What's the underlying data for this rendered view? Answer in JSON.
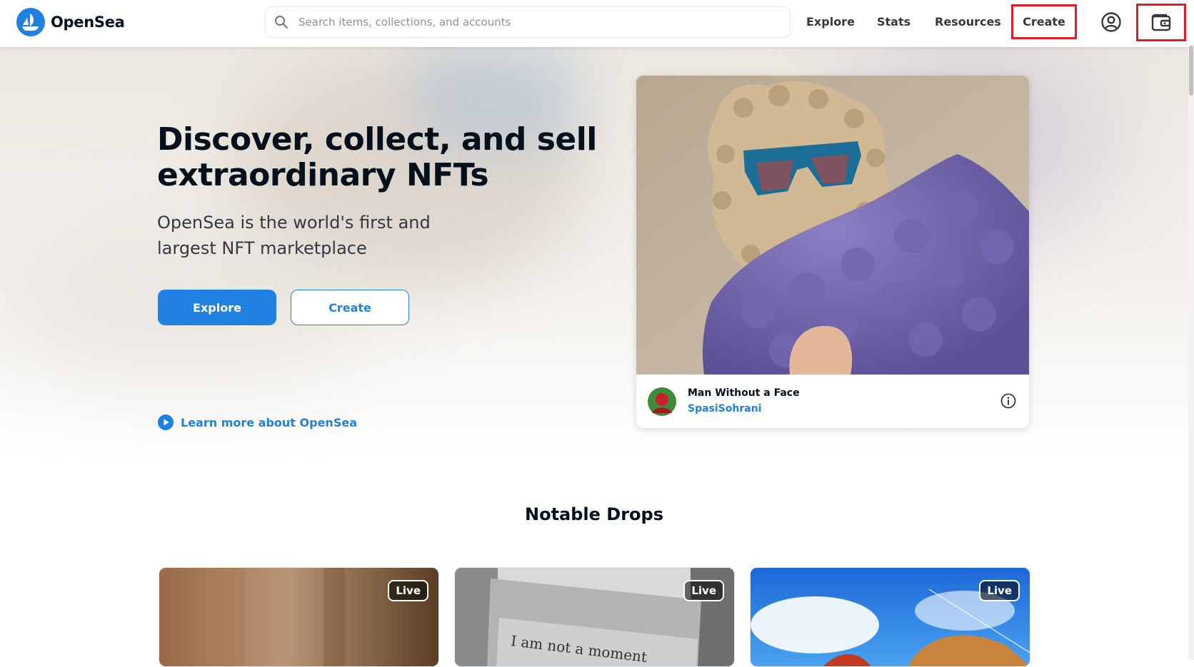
{
  "header": {
    "brand": "OpenSea",
    "search": {
      "placeholder": "Search items, collections, and accounts",
      "value": ""
    },
    "nav": {
      "explore": "Explore",
      "stats": "Stats",
      "resources": "Resources",
      "create": "Create"
    },
    "icons": {
      "logo": "opensea-logo-icon",
      "search": "search-icon",
      "account": "account-circle-icon",
      "wallet": "wallet-icon"
    }
  },
  "hero": {
    "title": "Discover, collect, and sell extraordinary NFTs",
    "subtitle": "OpenSea is the world's first and largest NFT marketplace",
    "explore_label": "Explore",
    "create_label": "Create",
    "learn_more": "Learn more about OpenSea"
  },
  "featured": {
    "nft_name": "Man Without a Face",
    "creator": "SpasiSohrani",
    "info_icon": "info-icon"
  },
  "notable_drops": {
    "title": "Notable Drops",
    "cards": [
      {
        "badge": "Live"
      },
      {
        "badge": "Live",
        "art_text": "I am not a moment"
      },
      {
        "badge": "Live"
      }
    ]
  },
  "colors": {
    "brand_blue": "#2081e2",
    "text_dark": "#04111d",
    "highlight_red": "#e31c25"
  }
}
